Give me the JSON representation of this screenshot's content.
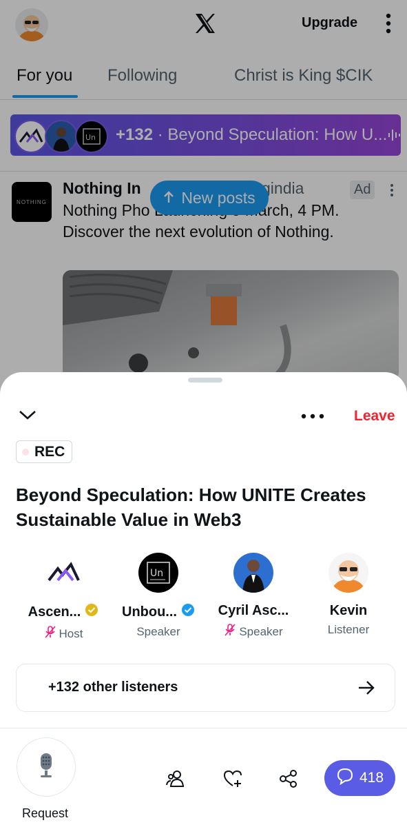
{
  "header": {
    "upgrade_label": "Upgrade"
  },
  "tabs": [
    {
      "label": "For you",
      "active": true
    },
    {
      "label": "Following",
      "active": false
    },
    {
      "label": "Christ is King $CIK",
      "active": false
    }
  ],
  "space_bar": {
    "count": "+132",
    "separator": "·",
    "title": "Beyond Speculation: How U..."
  },
  "post": {
    "avatar_text": "NOTHING",
    "name": "Nothing In",
    "handle": "gindia",
    "ad_label": "Ad",
    "body": "Nothing Pho                Launching 5 March, 4 PM. Discover the next evolution of Nothing."
  },
  "new_posts": {
    "label": "New posts"
  },
  "sheet": {
    "leave_label": "Leave",
    "rec_label": "REC",
    "title": "Beyond Speculation: How UNITE Creates Sustainable Value in Web3",
    "participants": [
      {
        "name": "Ascen...",
        "role": "Host",
        "verified": "gold",
        "muted": true
      },
      {
        "name": "Unbou...",
        "role": "Speaker",
        "verified": "blue",
        "muted": false
      },
      {
        "name": "Cyril Asc...",
        "role": "Speaker",
        "verified": "none",
        "muted": true
      },
      {
        "name": "Kevin",
        "role": "Listener",
        "verified": "none",
        "muted": false
      }
    ],
    "listeners_label": "+132 other listeners",
    "request_label": "Request",
    "chat_count": "418"
  },
  "colors": {
    "accent_blue": "#1d9bf0",
    "space_purple": "#5a5ce6",
    "leave_red": "#f4212e",
    "verified_gold": "#e2b719",
    "muted_pink": "#f91880"
  }
}
